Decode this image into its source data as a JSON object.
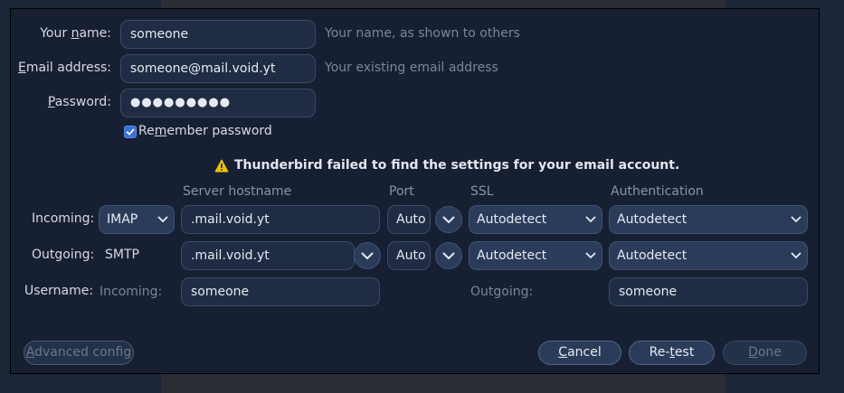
{
  "identity": {
    "name": {
      "label_pre": "Your ",
      "label_accel": "n",
      "label_post": "ame:",
      "value": "someone",
      "hint": "Your name, as shown to others"
    },
    "email": {
      "label_pre": "",
      "label_accel": "E",
      "label_post": "mail address:",
      "value": "someone@mail.void.yt",
      "hint": "Your existing email address"
    },
    "password": {
      "label_pre": "",
      "label_accel": "P",
      "label_post": "assword:",
      "value": "●●●●●●●●●"
    },
    "remember": {
      "label_pre": "Re",
      "label_accel": "m",
      "label_post": "ember password",
      "checked": true
    }
  },
  "warning": {
    "icon": "warning-icon",
    "text": "Thunderbird failed to find the settings for your email account."
  },
  "columns": {
    "server": "Server hostname",
    "port": "Port",
    "ssl": "SSL",
    "auth": "Authentication"
  },
  "incoming": {
    "label": "Incoming:",
    "protocol": "IMAP",
    "hostname": ".mail.void.yt",
    "port": "Auto",
    "ssl": "Autodetect",
    "auth": "Autodetect"
  },
  "outgoing": {
    "label": "Outgoing:",
    "protocol": "SMTP",
    "hostname": ".mail.void.yt",
    "port": "Auto",
    "ssl": "Autodetect",
    "auth": "Autodetect"
  },
  "username": {
    "label": "Username:",
    "incoming_label": "Incoming:",
    "incoming_value": "someone",
    "outgoing_label": "Outgoing:",
    "outgoing_value": "someone"
  },
  "buttons": {
    "advanced": {
      "accel": "A",
      "rest": "dvanced config"
    },
    "cancel": {
      "accel": "C",
      "rest": "ancel"
    },
    "retest": {
      "pre": "Re-",
      "accel": "t",
      "rest": "est"
    },
    "done": {
      "accel": "D",
      "rest": "one"
    }
  },
  "colors": {
    "background": "#172032",
    "accent": "#3a6fd8",
    "warning": "#f0c000"
  }
}
